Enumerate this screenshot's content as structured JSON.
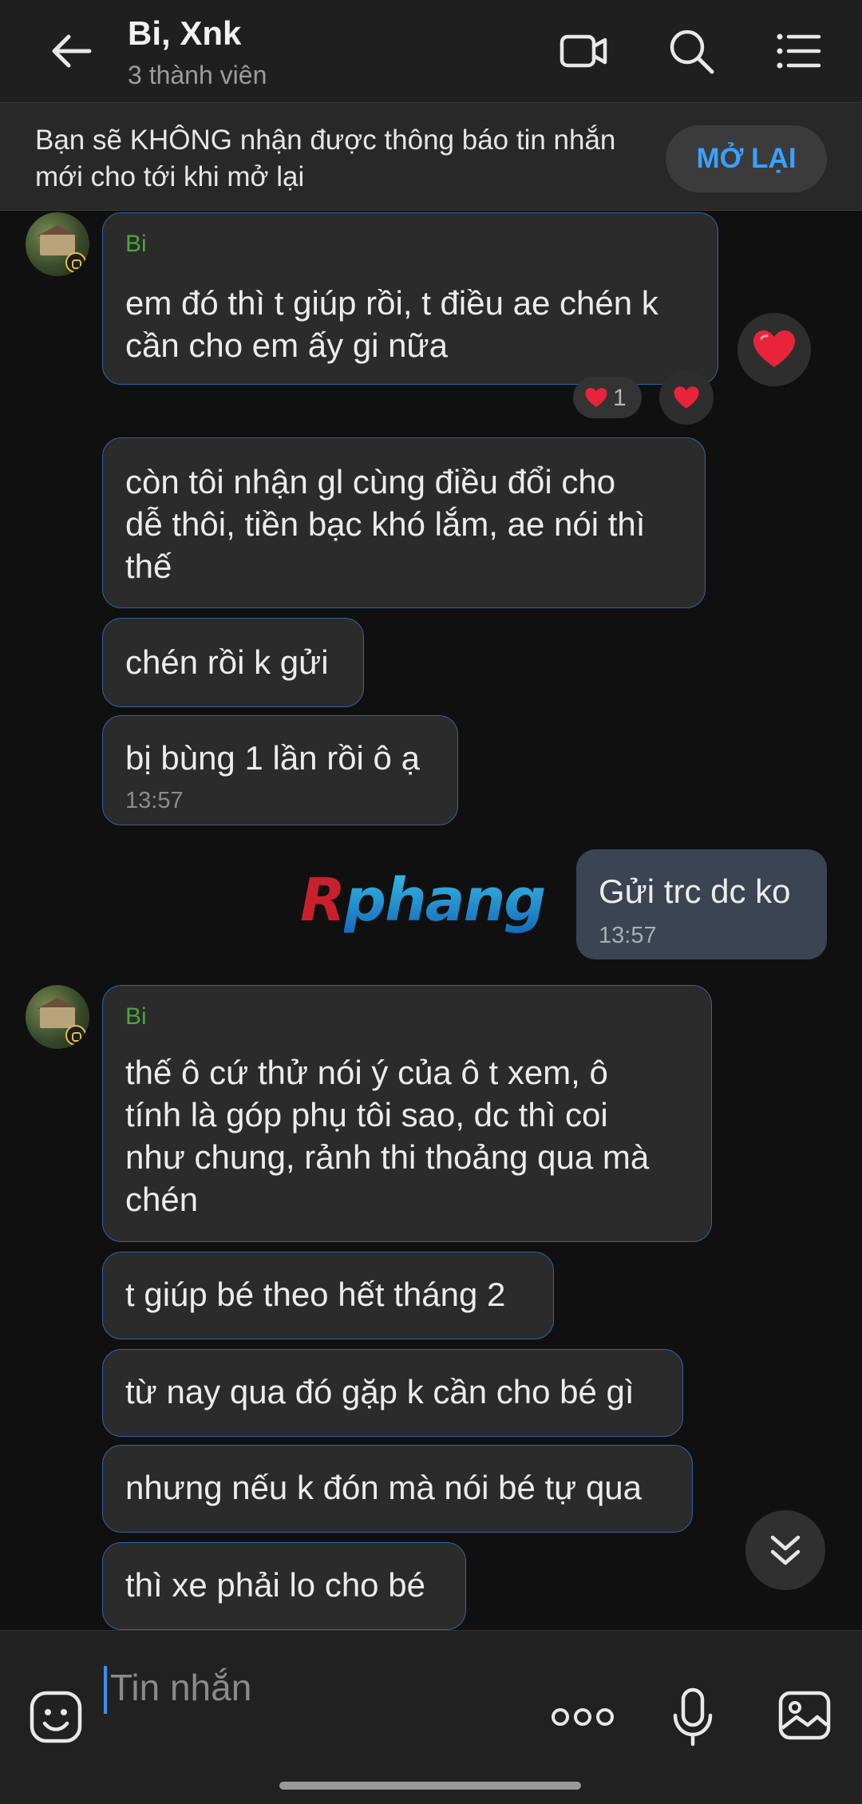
{
  "header": {
    "title": "Bi, Xnk",
    "subtitle": "3 thành viên"
  },
  "notice": {
    "text": "Bạn sẽ KHÔNG nhận được thông báo tin nhắn mới cho tới khi mở lại",
    "button_label": "MỞ LẠI"
  },
  "messages": [
    {
      "sender": "Bi",
      "text": "em đó thì t giúp rồi, t điều ae chén k\ncần cho em ấy gi nữa",
      "reaction_count": "1"
    },
    {
      "text": "còn tôi nhận gl cùng điều đổi cho\ndễ thôi, tiền bạc khó lắm, ae nói thì\nthế"
    },
    {
      "text": "chén rồi k gửi"
    },
    {
      "text": "bị bùng 1 lần rồi ô ạ",
      "time": "13:57"
    },
    {
      "text": "Gửi trc dc ko",
      "time": "13:57",
      "mine": true
    },
    {
      "sender": "Bi",
      "text": "thế ô cứ thử nói ý của ô t xem, ô\ntính là góp phụ tôi sao, dc thì coi\nnhư chung, rảnh thi thoảng qua mà\nchén"
    },
    {
      "text": "t giúp bé theo hết tháng 2"
    },
    {
      "text": "từ nay qua đó gặp k cần cho bé gì"
    },
    {
      "text": "nhưng nếu k đón mà nói bé tự qua"
    },
    {
      "text": "thì xe phải lo cho bé"
    }
  ],
  "watermark": {
    "first": "R",
    "rest": "phang"
  },
  "input": {
    "placeholder": "Tin nhắn"
  },
  "colors": {
    "background": "#101010",
    "bubble": "#2b2b2b",
    "bubble_border": "#2f63a6",
    "my_bubble": "#3a4452",
    "sender_name": "#4ca53a",
    "accent": "#3aa0ff"
  }
}
